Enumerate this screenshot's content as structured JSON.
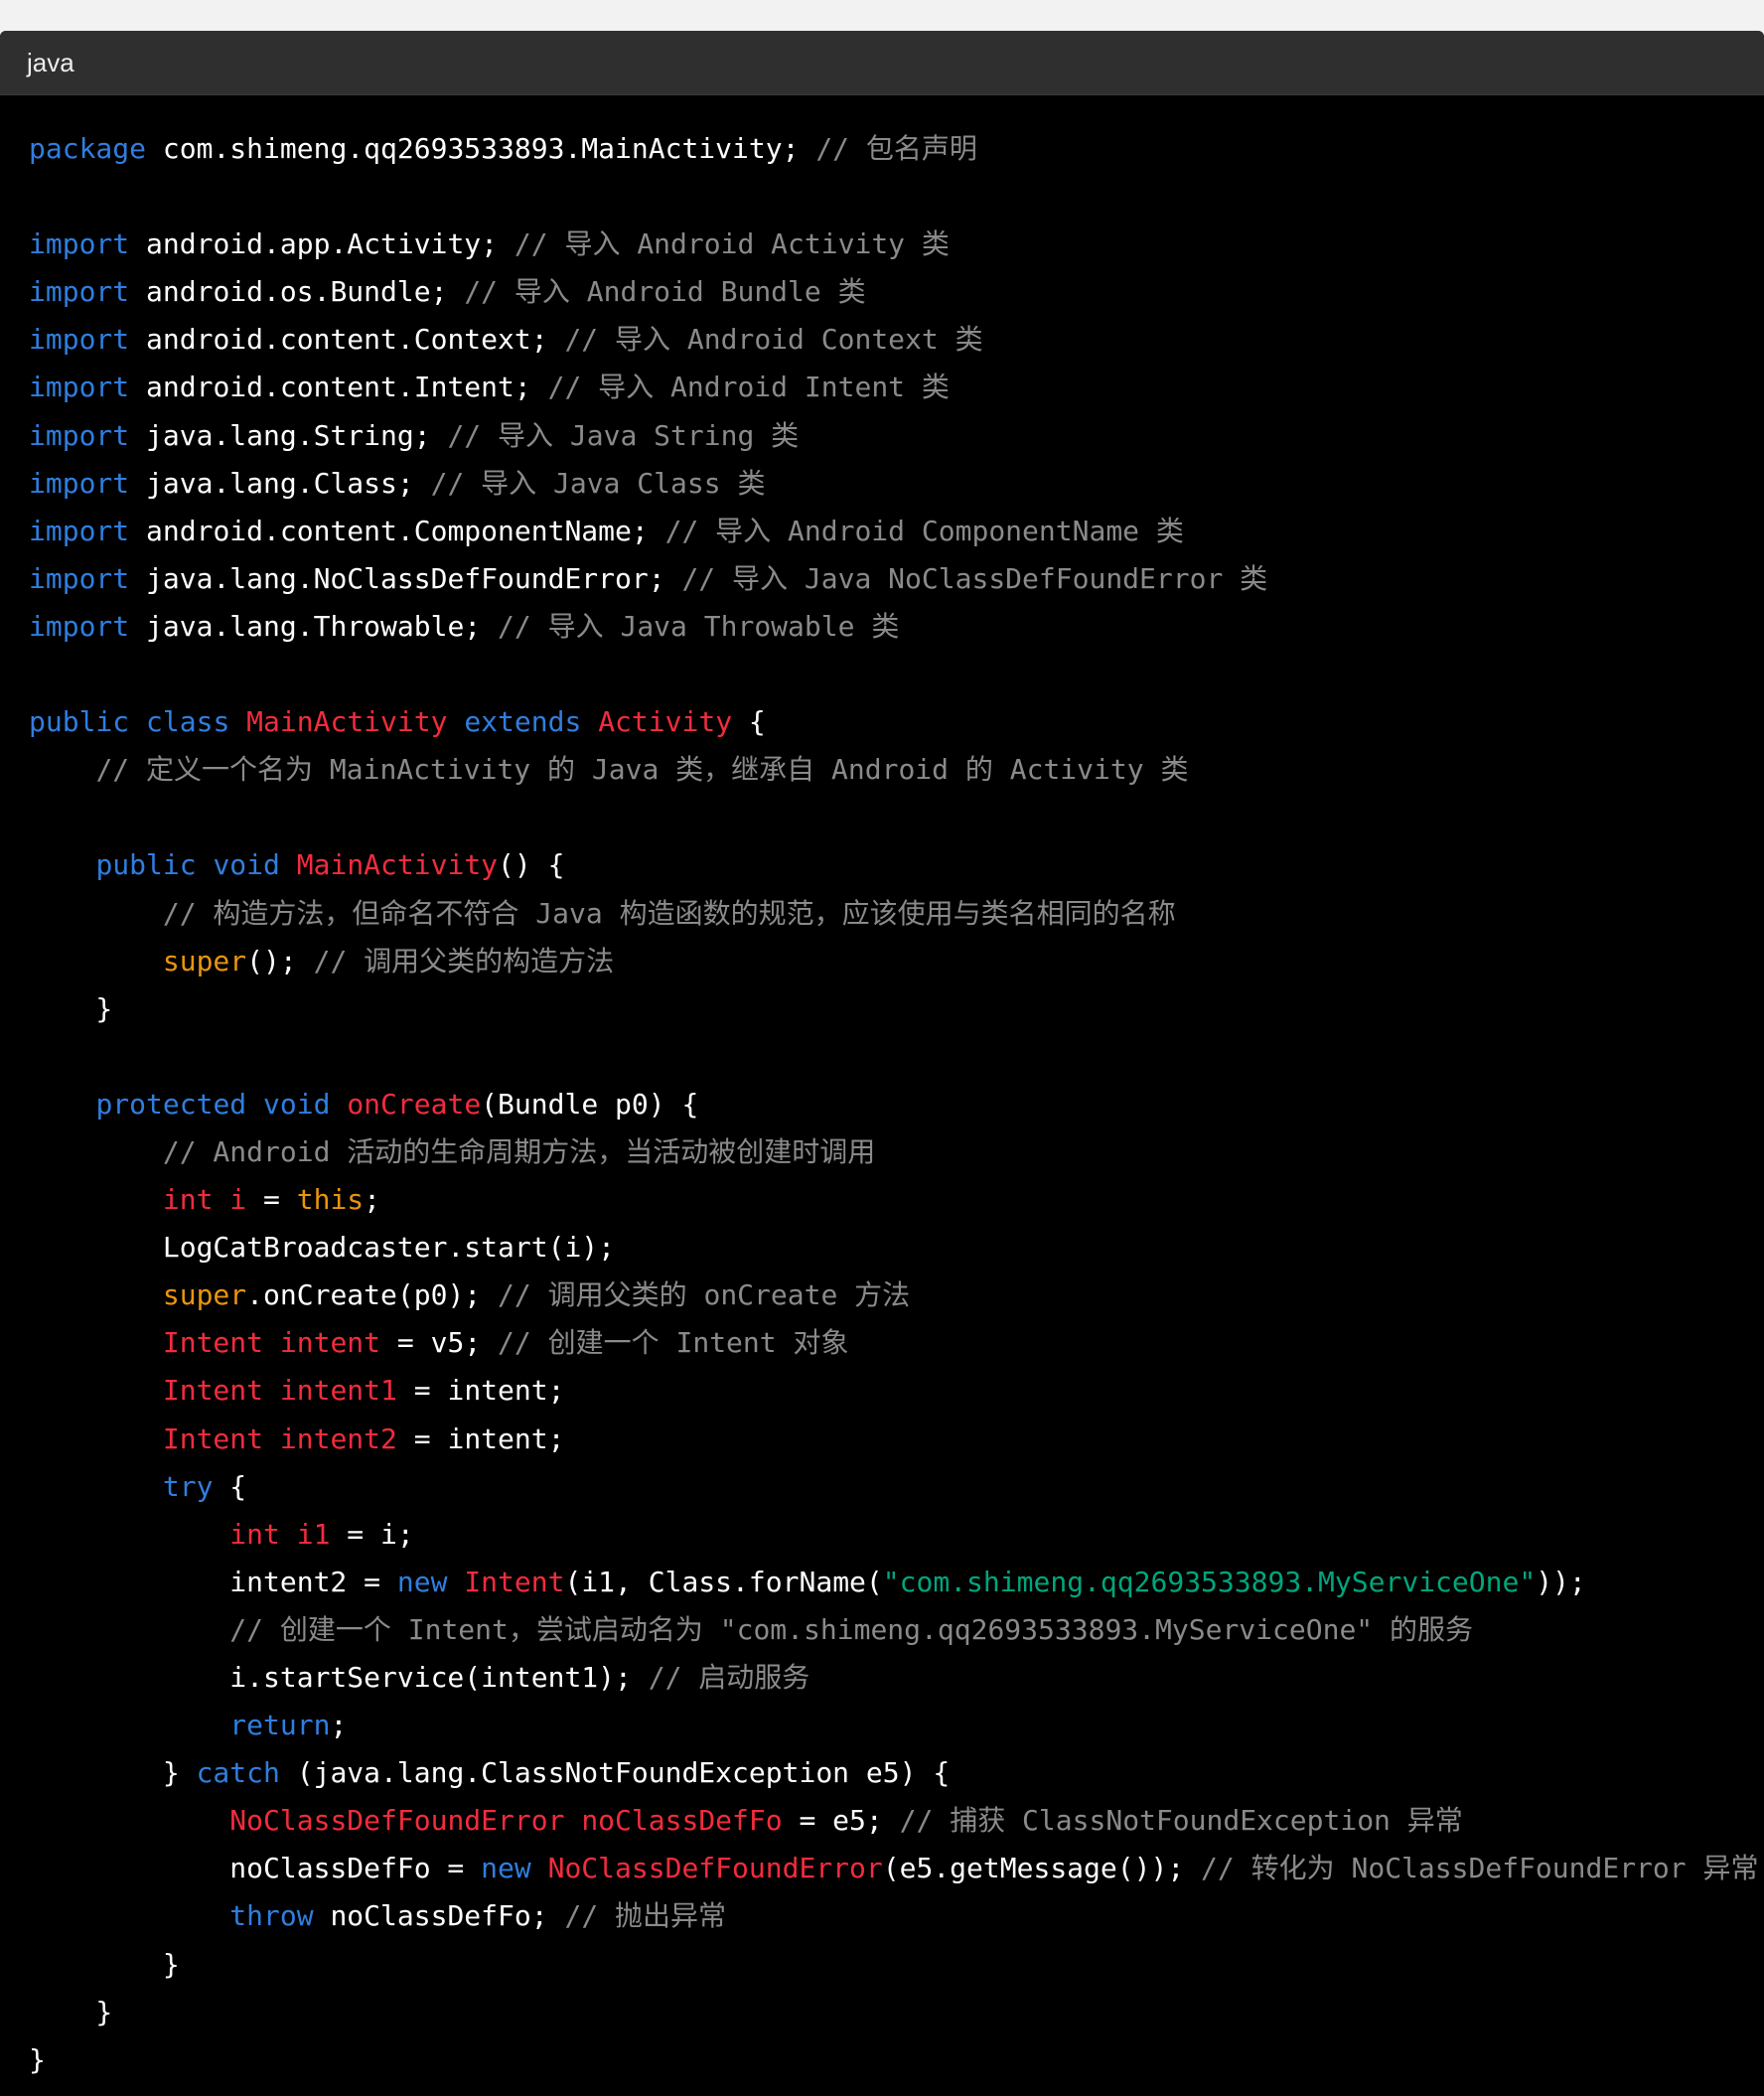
{
  "code_block": {
    "language": "java",
    "lines": [
      [
        [
          "kw",
          "package"
        ],
        [
          "pl",
          " com.shimeng.qq2693533893.MainActivity; "
        ],
        [
          "cm",
          "// 包名声明"
        ]
      ],
      [],
      [
        [
          "kw",
          "import"
        ],
        [
          "pl",
          " android.app.Activity; "
        ],
        [
          "cm",
          "// 导入 Android Activity 类"
        ]
      ],
      [
        [
          "kw",
          "import"
        ],
        [
          "pl",
          " android.os.Bundle; "
        ],
        [
          "cm",
          "// 导入 Android Bundle 类"
        ]
      ],
      [
        [
          "kw",
          "import"
        ],
        [
          "pl",
          " android.content.Context; "
        ],
        [
          "cm",
          "// 导入 Android Context 类"
        ]
      ],
      [
        [
          "kw",
          "import"
        ],
        [
          "pl",
          " android.content.Intent; "
        ],
        [
          "cm",
          "// 导入 Android Intent 类"
        ]
      ],
      [
        [
          "kw",
          "import"
        ],
        [
          "pl",
          " java.lang.String; "
        ],
        [
          "cm",
          "// 导入 Java String 类"
        ]
      ],
      [
        [
          "kw",
          "import"
        ],
        [
          "pl",
          " java.lang.Class; "
        ],
        [
          "cm",
          "// 导入 Java Class 类"
        ]
      ],
      [
        [
          "kw",
          "import"
        ],
        [
          "pl",
          " android.content.ComponentName; "
        ],
        [
          "cm",
          "// 导入 Android ComponentName 类"
        ]
      ],
      [
        [
          "kw",
          "import"
        ],
        [
          "pl",
          " java.lang.NoClassDefFoundError; "
        ],
        [
          "cm",
          "// 导入 Java NoClassDefFoundError 类"
        ]
      ],
      [
        [
          "kw",
          "import"
        ],
        [
          "pl",
          " java.lang.Throwable; "
        ],
        [
          "cm",
          "// 导入 Java Throwable 类"
        ]
      ],
      [],
      [
        [
          "kw",
          "public"
        ],
        [
          "pl",
          " "
        ],
        [
          "kw",
          "class"
        ],
        [
          "pl",
          " "
        ],
        [
          "ty",
          "MainActivity"
        ],
        [
          "pl",
          " "
        ],
        [
          "kw",
          "extends"
        ],
        [
          "pl",
          " "
        ],
        [
          "ty",
          "Activity"
        ],
        [
          "pl",
          " {"
        ]
      ],
      [
        [
          "pl",
          "    "
        ],
        [
          "cm",
          "// 定义一个名为 MainActivity 的 Java 类，继承自 Android 的 Activity 类"
        ]
      ],
      [],
      [
        [
          "pl",
          "    "
        ],
        [
          "kw",
          "public"
        ],
        [
          "pl",
          " "
        ],
        [
          "kw",
          "void"
        ],
        [
          "pl",
          " "
        ],
        [
          "fn",
          "MainActivity"
        ],
        [
          "pl",
          "() {"
        ]
      ],
      [
        [
          "pl",
          "        "
        ],
        [
          "cm",
          "// 构造方法，但命名不符合 Java 构造函数的规范，应该使用与类名相同的名称"
        ]
      ],
      [
        [
          "pl",
          "        "
        ],
        [
          "sp",
          "super"
        ],
        [
          "pl",
          "(); "
        ],
        [
          "cm",
          "// 调用父类的构造方法"
        ]
      ],
      [
        [
          "pl",
          "    }"
        ]
      ],
      [],
      [
        [
          "pl",
          "    "
        ],
        [
          "kw",
          "protected"
        ],
        [
          "pl",
          " "
        ],
        [
          "kw",
          "void"
        ],
        [
          "pl",
          " "
        ],
        [
          "fn",
          "onCreate"
        ],
        [
          "pl",
          "(Bundle p0) {"
        ]
      ],
      [
        [
          "pl",
          "        "
        ],
        [
          "cm",
          "// Android 活动的生命周期方法，当活动被创建时调用"
        ]
      ],
      [
        [
          "pl",
          "        "
        ],
        [
          "ty",
          "int"
        ],
        [
          "pl",
          " "
        ],
        [
          "ty",
          "i"
        ],
        [
          "pl",
          " = "
        ],
        [
          "sp",
          "this"
        ],
        [
          "pl",
          ";"
        ]
      ],
      [
        [
          "pl",
          "        LogCatBroadcaster.start(i);"
        ]
      ],
      [
        [
          "pl",
          "        "
        ],
        [
          "sp",
          "super"
        ],
        [
          "pl",
          ".onCreate(p0); "
        ],
        [
          "cm",
          "// 调用父类的 onCreate 方法"
        ]
      ],
      [
        [
          "pl",
          "        "
        ],
        [
          "ty",
          "Intent"
        ],
        [
          "pl",
          " "
        ],
        [
          "ty",
          "intent"
        ],
        [
          "pl",
          " = v5; "
        ],
        [
          "cm",
          "// 创建一个 Intent 对象"
        ]
      ],
      [
        [
          "pl",
          "        "
        ],
        [
          "ty",
          "Intent"
        ],
        [
          "pl",
          " "
        ],
        [
          "ty",
          "intent1"
        ],
        [
          "pl",
          " = intent;"
        ]
      ],
      [
        [
          "pl",
          "        "
        ],
        [
          "ty",
          "Intent"
        ],
        [
          "pl",
          " "
        ],
        [
          "ty",
          "intent2"
        ],
        [
          "pl",
          " = intent;"
        ]
      ],
      [
        [
          "pl",
          "        "
        ],
        [
          "kw",
          "try"
        ],
        [
          "pl",
          " {"
        ]
      ],
      [
        [
          "pl",
          "            "
        ],
        [
          "ty",
          "int"
        ],
        [
          "pl",
          " "
        ],
        [
          "ty",
          "i1"
        ],
        [
          "pl",
          " = i;"
        ]
      ],
      [
        [
          "pl",
          "            intent2 = "
        ],
        [
          "kw",
          "new"
        ],
        [
          "pl",
          " "
        ],
        [
          "fn",
          "Intent"
        ],
        [
          "pl",
          "(i1, Class.forName("
        ],
        [
          "st",
          "\"com.shimeng.qq2693533893.MyServiceOne\""
        ],
        [
          "pl",
          "));"
        ]
      ],
      [
        [
          "pl",
          "            "
        ],
        [
          "cm",
          "// 创建一个 Intent，尝试启动名为 \"com.shimeng.qq2693533893.MyServiceOne\" 的服务"
        ]
      ],
      [
        [
          "pl",
          "            i.startService(intent1); "
        ],
        [
          "cm",
          "// 启动服务"
        ]
      ],
      [
        [
          "pl",
          "            "
        ],
        [
          "kw",
          "return"
        ],
        [
          "pl",
          ";"
        ]
      ],
      [
        [
          "pl",
          "        } "
        ],
        [
          "kw",
          "catch"
        ],
        [
          "pl",
          " (java.lang.ClassNotFoundException e5) {"
        ]
      ],
      [
        [
          "pl",
          "            "
        ],
        [
          "ty",
          "NoClassDefFoundError"
        ],
        [
          "pl",
          " "
        ],
        [
          "ty",
          "noClassDefFo"
        ],
        [
          "pl",
          " = e5; "
        ],
        [
          "cm",
          "// 捕获 ClassNotFoundException 异常"
        ]
      ],
      [
        [
          "pl",
          "            noClassDefFo = "
        ],
        [
          "kw",
          "new"
        ],
        [
          "pl",
          " "
        ],
        [
          "fn",
          "NoClassDefFoundError"
        ],
        [
          "pl",
          "(e5.getMessage()); "
        ],
        [
          "cm",
          "// 转化为 NoClassDefFoundError 异常"
        ]
      ],
      [
        [
          "pl",
          "            "
        ],
        [
          "kw",
          "throw"
        ],
        [
          "pl",
          " noClassDefFo; "
        ],
        [
          "cm",
          "// 抛出异常"
        ]
      ],
      [
        [
          "pl",
          "        }"
        ]
      ],
      [
        [
          "pl",
          "    }"
        ]
      ],
      [
        [
          "pl",
          "}"
        ]
      ]
    ]
  }
}
